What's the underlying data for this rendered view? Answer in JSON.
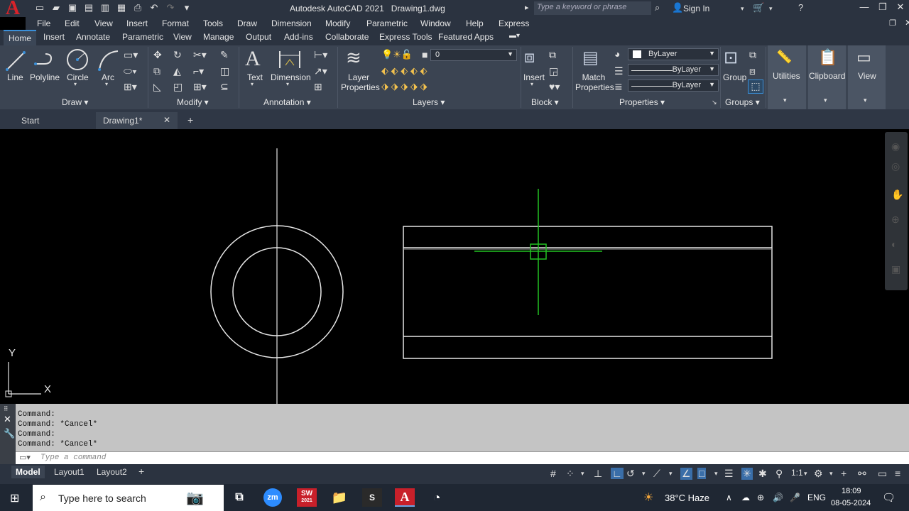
{
  "app": {
    "logo_letter": "A",
    "title": "Autodesk AutoCAD 2021",
    "filename": "Drawing1.dwg",
    "search_placeholder": "Type a keyword or phrase",
    "sign_in": "Sign In"
  },
  "menu": [
    "File",
    "Edit",
    "View",
    "Insert",
    "Format",
    "Tools",
    "Draw",
    "Dimension",
    "Modify",
    "Parametric",
    "Window",
    "Help",
    "Express"
  ],
  "ribbon_tabs": [
    "Home",
    "Insert",
    "Annotate",
    "Parametric",
    "View",
    "Manage",
    "Output",
    "Add-ins",
    "Collaborate",
    "Express Tools",
    "Featured Apps"
  ],
  "ribbon": {
    "draw": {
      "title": "Draw",
      "line": "Line",
      "polyline": "Polyline",
      "circle": "Circle",
      "arc": "Arc"
    },
    "modify": {
      "title": "Modify"
    },
    "annotation": {
      "title": "Annotation",
      "text": "Text",
      "dimension": "Dimension"
    },
    "layers": {
      "title": "Layers",
      "layer_properties": "Layer Properties",
      "current_layer": "0"
    },
    "block": {
      "title": "Block",
      "insert": "Insert"
    },
    "properties": {
      "title": "Properties",
      "match_properties": "Match Properties",
      "color": "ByLayer",
      "linetype": "ByLayer",
      "lineweight": "ByLayer"
    },
    "groups": {
      "title": "Groups",
      "group": "Group"
    },
    "utilities": "Utilities",
    "clipboard": "Clipboard",
    "view": "View"
  },
  "doc_tabs": {
    "start": "Start",
    "drawing": "Drawing1*"
  },
  "ucs": {
    "x": "X",
    "y": "Y"
  },
  "command": {
    "history": [
      "Command:",
      "Command: *Cancel*",
      "Command:",
      "Command: *Cancel*"
    ],
    "placeholder": "Type a command"
  },
  "layout_tabs": [
    "Model",
    "Layout1",
    "Layout2"
  ],
  "statusbar": {
    "scale": "1:1"
  },
  "taskbar": {
    "search_placeholder": "Type here to search",
    "weather": "38°C  Haze",
    "language": "ENG",
    "time": "18:09",
    "date": "08-05-2024",
    "app_zoom": "zm",
    "app_sw": "SW",
    "app_sw_year": "2021",
    "app_s": "S"
  },
  "colors": {
    "crosshair": "#22c322",
    "geometry": "#e6e6e6",
    "accent": "#3a8fd8",
    "brand_red": "#d8232a"
  }
}
